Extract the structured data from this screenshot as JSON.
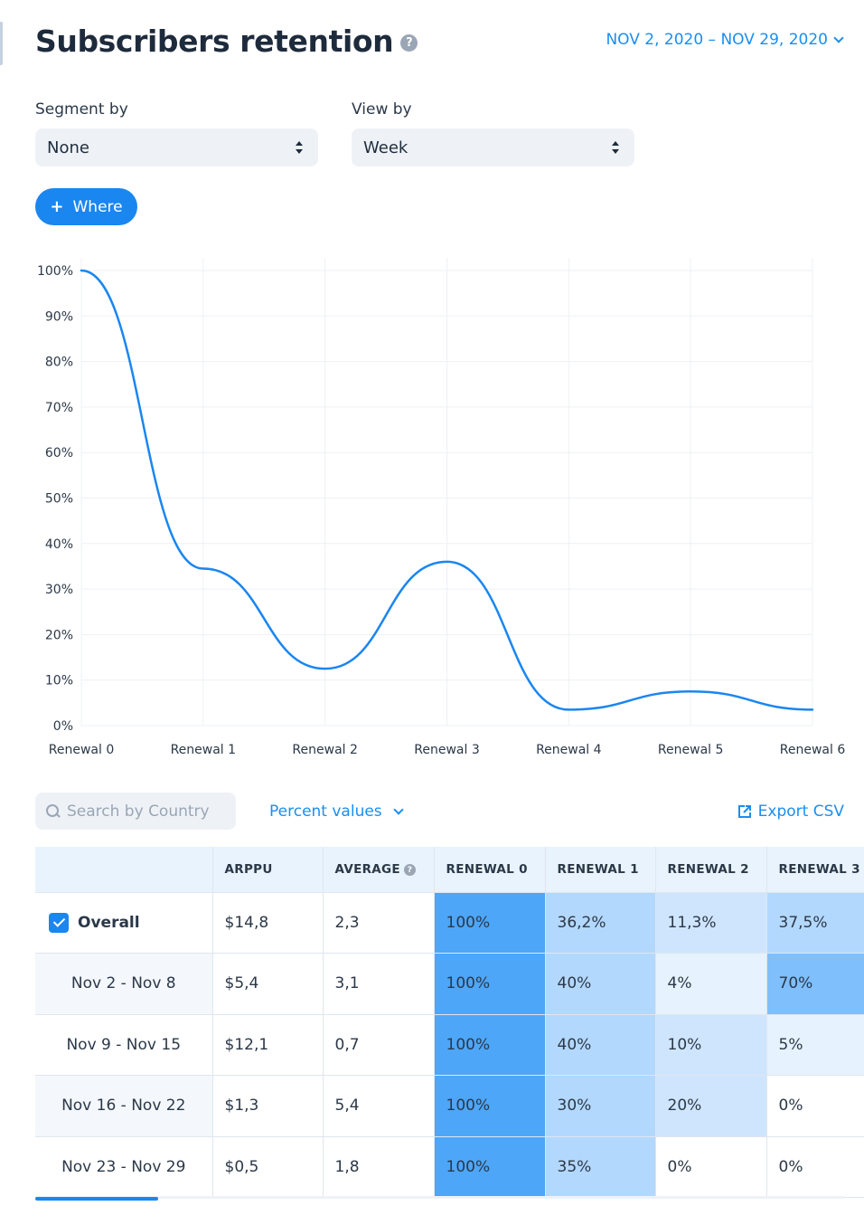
{
  "header": {
    "title": "Subscribers retention",
    "date_range": "NOV 2, 2020 – NOV 29, 2020"
  },
  "filters": {
    "segment_label": "Segment by",
    "segment_value": "None",
    "view_label": "View by",
    "view_value": "Week",
    "where_label": "Where"
  },
  "chart_data": {
    "type": "line",
    "categories": [
      "Renewal 0",
      "Renewal 1",
      "Renewal 2",
      "Renewal 3",
      "Renewal 4",
      "Renewal 5",
      "Renewal 6"
    ],
    "series": [
      {
        "values": [
          100,
          34.5,
          12.5,
          36,
          3.5,
          7.5,
          3.5
        ]
      }
    ],
    "y_ticks": [
      "0%",
      "10%",
      "20%",
      "30%",
      "40%",
      "50%",
      "60%",
      "70%",
      "80%",
      "90%",
      "100%"
    ],
    "ylim": [
      0,
      100
    ],
    "grid": true,
    "line_color": "#1a86f0"
  },
  "toolbar": {
    "search_placeholder": "Search by Country",
    "percent_toggle": "Percent values",
    "export_label": "Export CSV"
  },
  "table": {
    "headers": [
      "",
      "ARPPU",
      "AVERAGE",
      "RENEWAL 0",
      "RENEWAL 1",
      "RENEWAL 2",
      "RENEWAL 3"
    ],
    "rows": [
      {
        "label": "Overall",
        "arppu": "$14,8",
        "average": "2,3",
        "renewals": [
          "100%",
          "36,2%",
          "11,3%",
          "37,5%"
        ]
      },
      {
        "label": "Nov 2 - Nov 8",
        "arppu": "$5,4",
        "average": "3,1",
        "renewals": [
          "100%",
          "40%",
          "4%",
          "70%"
        ]
      },
      {
        "label": "Nov 9 - Nov 15",
        "arppu": "$12,1",
        "average": "0,7",
        "renewals": [
          "100%",
          "40%",
          "10%",
          "5%"
        ]
      },
      {
        "label": "Nov 16 - Nov 22",
        "arppu": "$1,3",
        "average": "5,4",
        "renewals": [
          "100%",
          "30%",
          "20%",
          "0%"
        ]
      },
      {
        "label": "Nov 23 - Nov 29",
        "arppu": "$0,5",
        "average": "1,8",
        "renewals": [
          "100%",
          "35%",
          "0%",
          "0%"
        ]
      }
    ],
    "heat_colors": [
      "#ffffff",
      "#e6f2fe",
      "#cfe5fd",
      "#b3d8fd",
      "#7fbffb",
      "#4da6f8"
    ]
  }
}
